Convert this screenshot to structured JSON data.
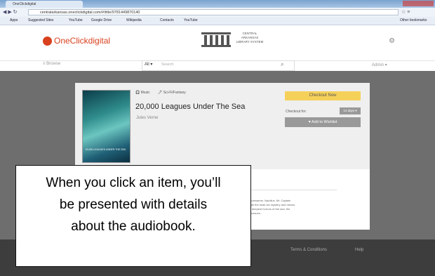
{
  "browser": {
    "tab_title": "OneClickdigital",
    "url": "centralarkansas.oneclickdigital.com/#/title/9781449870140",
    "bookmarks": [
      "Apps",
      "Suggested Sites",
      "YouTube",
      "Google Drive",
      "Wikipedia",
      "Contacts",
      "YouTube"
    ],
    "other_bookmarks": "Other bookmarks"
  },
  "site": {
    "logo_text": "OneClickdigital",
    "library_name": "CENTRAL ARKANSAS LIBRARY SYSTEM",
    "browse_label": "≡ Browse",
    "search_scope": "All ▾",
    "search_placeholder": "Search",
    "account_label": "Admin ▾"
  },
  "book": {
    "badge_music": "Music",
    "badge_kids": "Sci-Fi/Fantasy",
    "title": "20,000 Leagues Under The Sea",
    "author": "Jules Verne",
    "cover_caption": "20,000 LEAGUES UNDER THE SEA",
    "checkout_label": "Checkout Now",
    "checkout_for_label": "Checkout for:",
    "checkout_period": "14 days ▾",
    "wishlist_label": "♥ Add to Wishlist",
    "description_lines": [
      "amazing submarine, Nautilus. Mr. Captain",
      "personal will the seas via mystery and menac",
      "pet on the deepest horrors of the sea, the",
      "quest he pursues."
    ]
  },
  "footer": {
    "links": [
      "Terms & Conditions",
      "Help"
    ]
  },
  "caption": {
    "lines": [
      "When you click an item, you’ll",
      "be presented with details",
      "about the audiobook."
    ]
  }
}
